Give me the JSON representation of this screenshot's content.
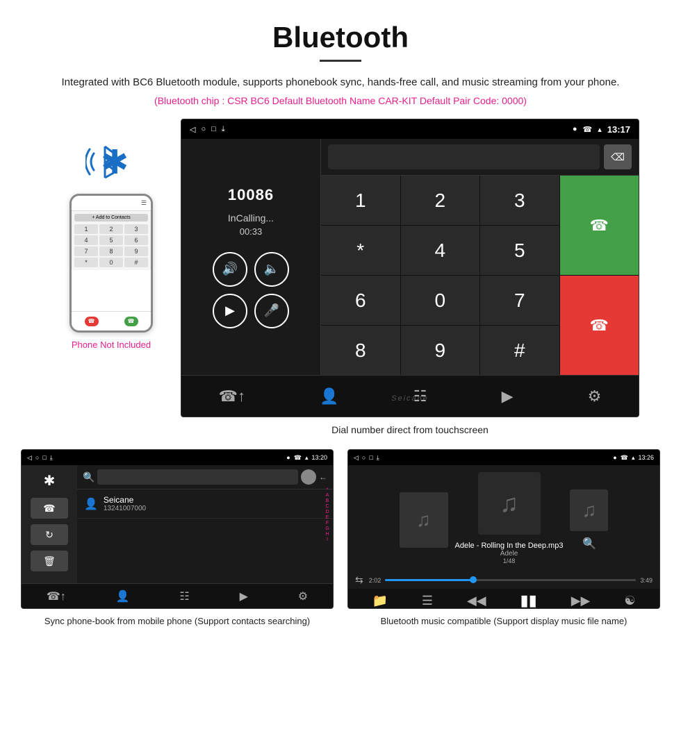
{
  "page": {
    "title": "Bluetooth",
    "description": "Integrated with BC6 Bluetooth module, supports phonebook sync, hands-free call, and music streaming from your phone.",
    "specs": "(Bluetooth chip : CSR BC6    Default Bluetooth Name CAR-KIT    Default Pair Code: 0000)"
  },
  "header": {
    "time": "13:17",
    "time2": "13:20",
    "time3": "13:26"
  },
  "caller": {
    "number": "10086",
    "status": "InCalling...",
    "duration": "00:33"
  },
  "keypad": {
    "keys": [
      "1",
      "2",
      "3",
      "*",
      "4",
      "5",
      "6",
      "0",
      "7",
      "8",
      "9",
      "#"
    ]
  },
  "phonebook": {
    "contact_name": "Seicane",
    "contact_number": "13241007000"
  },
  "music": {
    "title": "Adele - Rolling In the Deep.mp3",
    "artist": "Adele",
    "track": "1/48",
    "time_current": "2:02",
    "time_total": "3:49",
    "search_icon": "🔍"
  },
  "captions": {
    "dial": "Dial number direct from touchscreen",
    "phonebook": "Sync phone-book from mobile phone\n(Support contacts searching)",
    "music": "Bluetooth music compatible\n(Support display music file name)"
  },
  "phone_side": {
    "not_included": "Phone Not Included"
  },
  "alpha_bar": [
    "*",
    "A",
    "B",
    "C",
    "D",
    "E",
    "F",
    "G",
    "H",
    "I"
  ]
}
